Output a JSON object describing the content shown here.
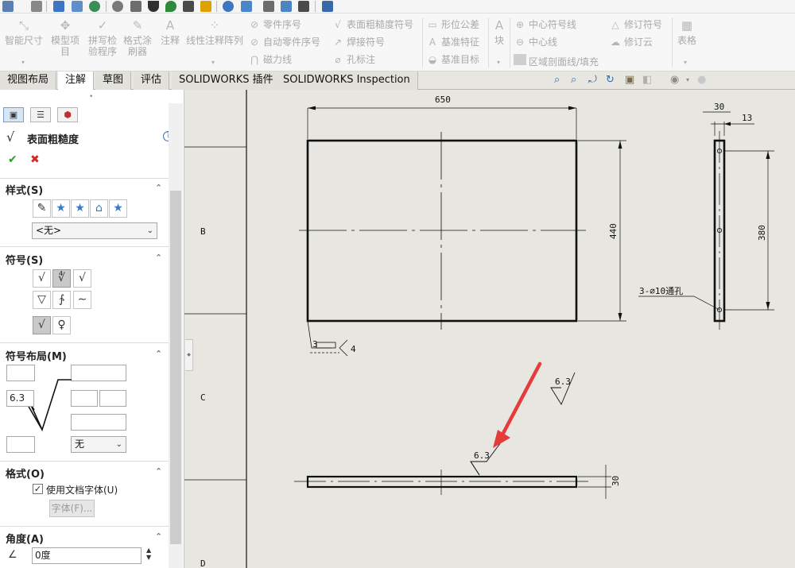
{
  "ribbon": {
    "smart_dimension": "智能尺寸",
    "model_items_1": "模型项",
    "model_items_2": "目",
    "spell_check_1": "拼写检",
    "spell_check_2": "验程序",
    "format_painter_1": "格式涂",
    "format_painter_2": "刷器",
    "note": "注释",
    "linear_note_pattern": "线性注释阵列",
    "balloon": "零件序号",
    "auto_balloon": "自动零件序号",
    "magnetic_line": "磁力线",
    "surface_finish": "表面粗糙度符号",
    "weld_symbol": "焊接符号",
    "hole_callout": "孔标注",
    "geometric_tolerance": "形位公差",
    "datum_feature": "基准特征",
    "datum_target": "基准目标",
    "block": "块",
    "center_mark": "中心符号线",
    "centerline": "中心线",
    "area_hatch": "区域剖面线/填充",
    "revision_symbol": "修订符号",
    "revision_cloud": "修订云",
    "table": "表格"
  },
  "tabs": [
    "视图布局",
    "注解",
    "草图",
    "评估",
    "SOLIDWORKS 插件",
    "SOLIDWORKS Inspection"
  ],
  "active_tab": 1,
  "panel": {
    "title": "表面粗糙度",
    "style_header": "样式(S)",
    "style_dropdown": "<无>",
    "symbol_header": "符号(S)",
    "layout_header": "符号布局(M)",
    "roughness_value": "6.3",
    "lay_direction": "无",
    "format_header": "格式(O)",
    "use_doc_font_label": "使用文档字体(U)",
    "use_doc_font_checked": true,
    "font_button": "字体(F)...",
    "angle_header": "角度(A)",
    "angle_value": "0度"
  },
  "drawing": {
    "zone_labels": [
      "B",
      "C",
      "D"
    ],
    "dim_width": "650",
    "dim_height": "440",
    "dim_side_30": "30",
    "dim_side_13": "13",
    "dim_side_380": "380",
    "hole_note": "3-∅10通孔",
    "weld_left": "3",
    "weld_right": "4",
    "finish_default": "6.3",
    "finish_on_part": "6.3",
    "dim_bottom_30": "30"
  },
  "colors": {
    "sheet_bg": "#e7e6e0",
    "annotation_arrow": "#e53b3b",
    "active_tab_bg": "#ffffff",
    "accept_check": "#2e9b2e",
    "cancel_x": "#d12a2a"
  }
}
